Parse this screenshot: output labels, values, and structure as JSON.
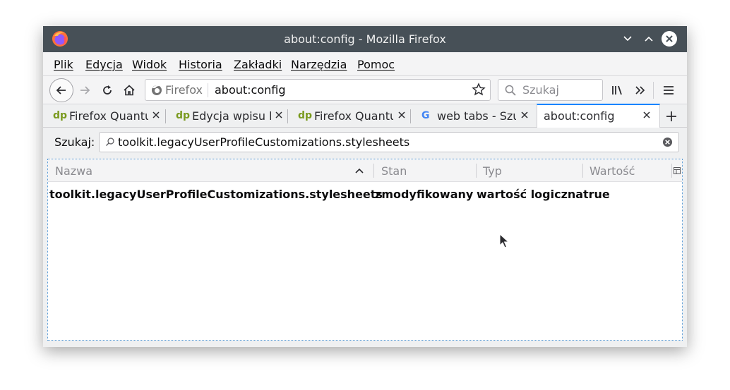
{
  "window": {
    "title": "about:config - Mozilla Firefox"
  },
  "menubar": {
    "items": [
      {
        "label": "Plik"
      },
      {
        "label": "Edycja"
      },
      {
        "label": "Widok"
      },
      {
        "label": "Historia"
      },
      {
        "label": "Zakładki"
      },
      {
        "label": "Narzędzia"
      },
      {
        "label": "Pomoc"
      }
    ]
  },
  "navbar": {
    "identity_label": "Firefox",
    "url": "about:config",
    "search_placeholder": "Szukaj"
  },
  "tabs": [
    {
      "label": "Firefox Quantum",
      "favicon": "dp",
      "active": false
    },
    {
      "label": "Edycja wpisu b",
      "favicon": "dp",
      "active": false
    },
    {
      "label": "Firefox Quantum",
      "favicon": "dp",
      "active": false
    },
    {
      "label": "web tabs - Szuk",
      "favicon": "G",
      "active": false
    },
    {
      "label": "about:config",
      "favicon": "",
      "active": true
    }
  ],
  "config": {
    "search_label": "Szukaj:",
    "search_value": "toolkit.legacyUserProfileCustomizations.stylesheets",
    "columns": {
      "name": "Nazwa",
      "status": "Stan",
      "type": "Typ",
      "value": "Wartość"
    },
    "rows": [
      {
        "name": "toolkit.legacyUserProfileCustomizations.stylesheets",
        "status": "zmodyfikowany",
        "type": "wartość logiczna",
        "value": "true"
      }
    ]
  },
  "colors": {
    "titlebar": "#475057",
    "accent": "#0a84ff",
    "dp_favicon": "#7a9a1f"
  }
}
